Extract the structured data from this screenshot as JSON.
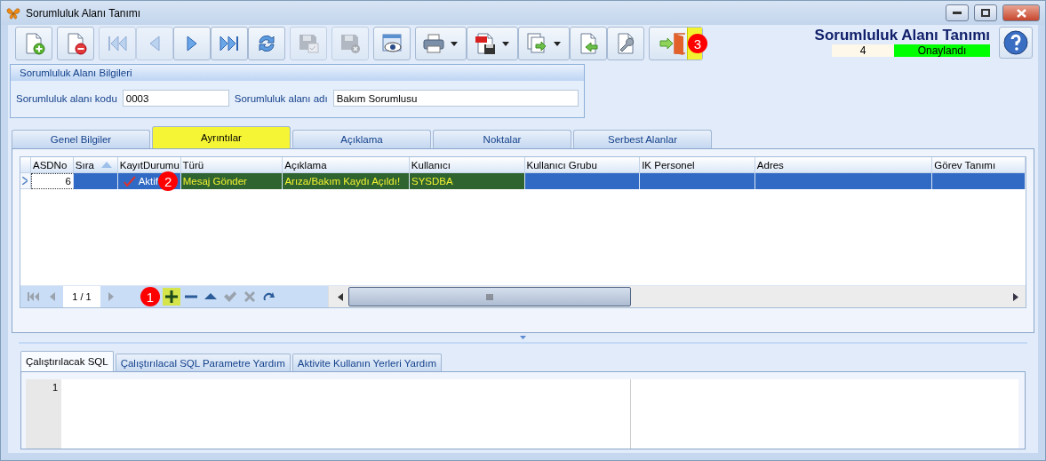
{
  "window": {
    "title": "Sorumluluk Alanı Tanımı"
  },
  "toolbar": {
    "groups": [
      {
        "buttons": [
          {
            "kind": "new",
            "disabled": false,
            "dropdown": false,
            "highlighted": false
          }
        ]
      },
      {
        "buttons": [
          {
            "kind": "delete",
            "disabled": false,
            "dropdown": false,
            "highlighted": false
          }
        ]
      },
      {
        "buttons": [
          {
            "kind": "first",
            "disabled": true,
            "dropdown": false,
            "highlighted": false
          },
          {
            "kind": "prev",
            "disabled": true,
            "dropdown": false,
            "highlighted": false
          },
          {
            "kind": "next",
            "disabled": false,
            "dropdown": false,
            "highlighted": false
          },
          {
            "kind": "last",
            "disabled": false,
            "dropdown": false,
            "highlighted": false
          },
          {
            "kind": "refresh",
            "disabled": false,
            "dropdown": false,
            "highlighted": false
          }
        ]
      },
      {
        "buttons": [
          {
            "kind": "save",
            "disabled": true,
            "dropdown": false,
            "highlighted": false
          }
        ]
      },
      {
        "buttons": [
          {
            "kind": "cancel",
            "disabled": true,
            "dropdown": false,
            "highlighted": false
          }
        ]
      },
      {
        "buttons": [
          {
            "kind": "preview",
            "disabled": false,
            "dropdown": false,
            "highlighted": false
          }
        ]
      },
      {
        "buttons": [
          {
            "kind": "print",
            "disabled": false,
            "dropdown": true,
            "highlighted": false
          },
          {
            "kind": "pdf",
            "disabled": false,
            "dropdown": true,
            "highlighted": false
          },
          {
            "kind": "export",
            "disabled": false,
            "dropdown": true,
            "highlighted": false
          },
          {
            "kind": "import",
            "disabled": false,
            "dropdown": false,
            "highlighted": false
          },
          {
            "kind": "tools",
            "disabled": false,
            "dropdown": false,
            "highlighted": false
          }
        ]
      },
      {
        "buttons": [
          {
            "kind": "exit",
            "disabled": false,
            "dropdown": true,
            "highlighted": true,
            "badge": "3"
          }
        ]
      }
    ]
  },
  "header": {
    "title": "Sorumluluk Alanı Tanımı",
    "record_number": "4",
    "status": "Onaylandı"
  },
  "info_group": {
    "title": "Sorumluluk Alanı Bilgileri",
    "fields": [
      {
        "label": "Sorumluluk alanı kodu",
        "value": "0003"
      },
      {
        "label": "Sorumluluk alanı adı",
        "value": "Bakım Sorumlusu"
      }
    ]
  },
  "tabs": [
    {
      "label": "Genel Bilgiler",
      "selected": false
    },
    {
      "label": "Ayrıntılar",
      "selected": true
    },
    {
      "label": "Açıklama",
      "selected": false
    },
    {
      "label": "Noktalar",
      "selected": false
    },
    {
      "label": "Serbest Alanlar",
      "selected": false
    }
  ],
  "grid": {
    "columns": [
      {
        "label": "ASDNo",
        "sorted": false
      },
      {
        "label": "Sıra",
        "sorted": true
      },
      {
        "label": "KayıtDurumu",
        "sorted": false
      },
      {
        "label": "Türü",
        "sorted": false
      },
      {
        "label": "Açıklama",
        "sorted": false
      },
      {
        "label": "Kullanıcı",
        "sorted": false
      },
      {
        "label": "Kullanıcı Grubu",
        "sorted": false
      },
      {
        "label": "IK Personel",
        "sorted": false
      },
      {
        "label": "Adres",
        "sorted": false
      },
      {
        "label": "Görev Tanımı",
        "sorted": false
      }
    ],
    "rows": [
      {
        "selected": true,
        "cells": [
          {
            "text": "6",
            "highlighted": false
          },
          {
            "highlighted": false
          },
          {
            "text": "Aktif",
            "checked": true,
            "badge": "2",
            "highlighted": false
          },
          {
            "text": "Mesaj Gönder",
            "highlighted": true
          },
          {
            "text": "Arıza/Bakım Kaydı Açıldı!",
            "highlighted": true
          },
          {
            "text": "SYSDBA",
            "highlighted": true
          },
          {
            "highlighted": false
          },
          {
            "highlighted": false
          },
          {
            "highlighted": false
          },
          {
            "highlighted": false
          }
        ]
      }
    ]
  },
  "navigator": {
    "page": "1 / 1",
    "buttons": [
      {
        "kind": "first",
        "disabled": true,
        "highlighted": false
      },
      {
        "kind": "prev",
        "disabled": true,
        "highlighted": false
      },
      {
        "kind": "next",
        "disabled": true,
        "highlighted": false
      },
      {
        "kind": "add",
        "disabled": false,
        "highlighted": true,
        "badge": "1"
      },
      {
        "kind": "remove",
        "disabled": false,
        "highlighted": false
      },
      {
        "kind": "up",
        "disabled": false,
        "highlighted": false
      },
      {
        "kind": "confirm",
        "disabled": true,
        "highlighted": false
      },
      {
        "kind": "discard",
        "disabled": true,
        "highlighted": false
      },
      {
        "kind": "redo",
        "disabled": false,
        "highlighted": false
      }
    ]
  },
  "bottom_tabs": [
    {
      "label": "Çalıştırılacak SQL",
      "selected": true
    },
    {
      "label": "Çalıştırılacal SQL Parametre Yardım",
      "selected": false
    },
    {
      "label": "Aktivite Kullanın Yerleri Yardım",
      "selected": false
    }
  ],
  "editor": {
    "line_numbers": [
      "1"
    ]
  }
}
